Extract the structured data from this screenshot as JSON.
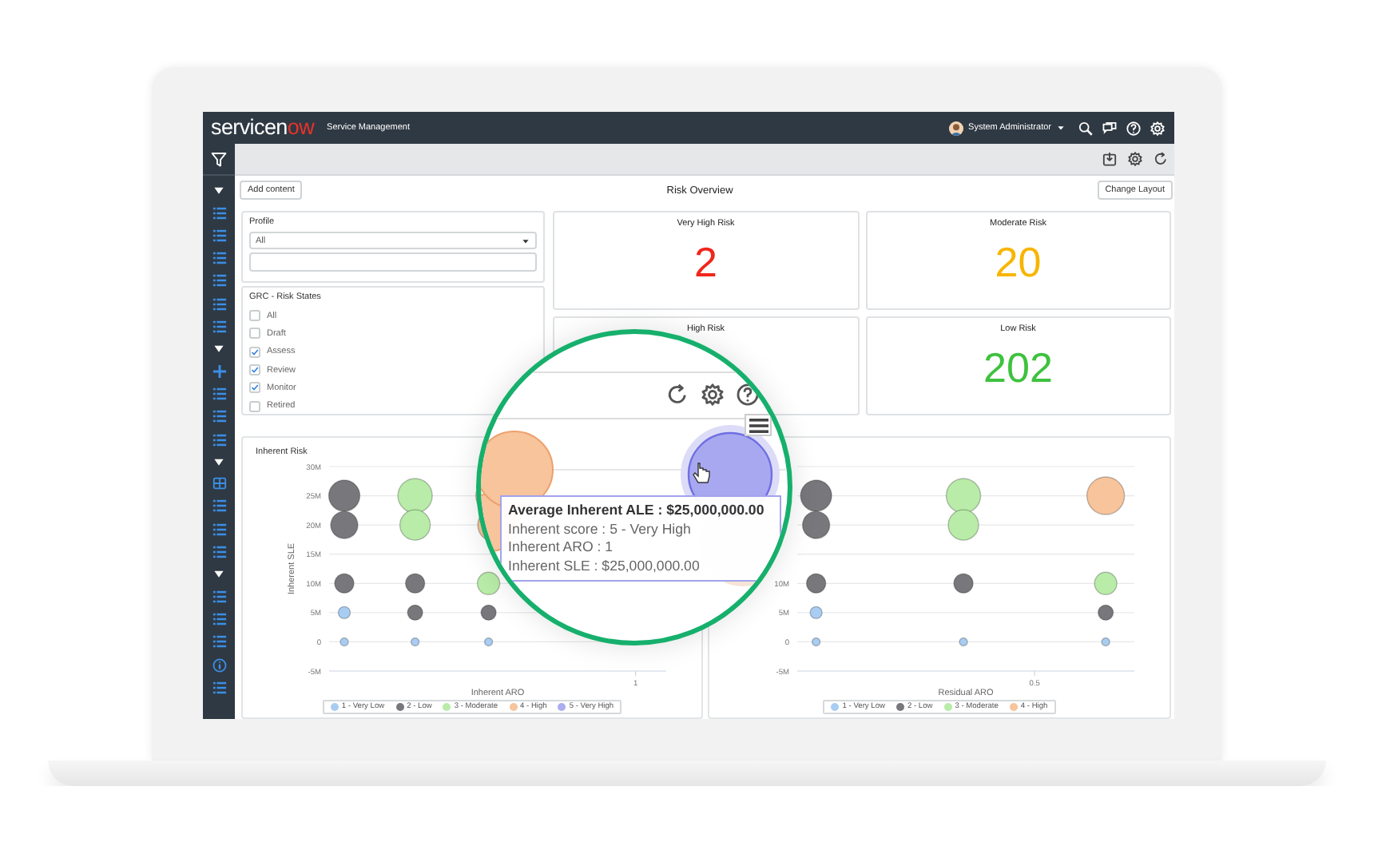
{
  "top_bar": {
    "logo": "servicenow",
    "app_name": "Service Management",
    "user": "System Administrator"
  },
  "header": {
    "add_button": "Add content",
    "title": "Risk Overview",
    "layout_button": "Change Layout"
  },
  "profile": {
    "label": "Profile",
    "select_value": "All"
  },
  "risk_states": {
    "title": "GRC - Risk States",
    "options": [
      {
        "label": "All",
        "checked": false
      },
      {
        "label": "Draft",
        "checked": false
      },
      {
        "label": "Assess",
        "checked": true
      },
      {
        "label": "Review",
        "checked": true
      },
      {
        "label": "Monitor",
        "checked": true
      },
      {
        "label": "Retired",
        "checked": false
      }
    ]
  },
  "metrics": [
    {
      "label": "Very High Risk",
      "value": "2",
      "color": "#f0261b"
    },
    {
      "label": "Moderate Risk",
      "value": "20",
      "color": "#f7b500"
    },
    {
      "label": "High Risk"
    },
    {
      "label": "Low Risk",
      "value": "202",
      "color": "#3ec23e"
    }
  ],
  "charts": [
    {
      "kind": "inherent",
      "title": "Inherent Risk",
      "xlabel": "Inherent ARO",
      "ylabel": "Inherent SLE",
      "x_tick_label": "1",
      "y_tick_labels": [
        "30M",
        "25M",
        "20M",
        "15M",
        "10M",
        "5M",
        "0",
        "-5M"
      ],
      "legend": [
        {
          "label": "1 - Very Low",
          "color": "#a9cdf2"
        },
        {
          "label": "2 - Low",
          "color": "#77777c"
        },
        {
          "label": "3 - Moderate",
          "color": "#b8eca8"
        },
        {
          "label": "4 - High",
          "color": "#f7c49b"
        },
        {
          "label": "5 - Very High",
          "color": "#acacf0"
        }
      ]
    },
    {
      "kind": "residual",
      "xlabel": "Residual ARO",
      "x_tick_label": "0.5",
      "y_tick_labels": [
        "10M",
        "5M",
        "0",
        "-5M"
      ],
      "legend": [
        {
          "label": "1 - Very Low",
          "color": "#a9cdf2"
        },
        {
          "label": "2 - Low",
          "color": "#77777c"
        },
        {
          "label": "3 - Moderate",
          "color": "#b8eca8"
        },
        {
          "label": "4 - High",
          "color": "#f7c49b"
        }
      ]
    }
  ],
  "magnifier": {
    "tooltip": {
      "title": "Average Inherent ALE : $25,000,000.00",
      "lines": [
        "Inherent score : 5 - Very High",
        "Inherent ARO : 1",
        "Inherent SLE : $25,000,000.00"
      ]
    }
  }
}
